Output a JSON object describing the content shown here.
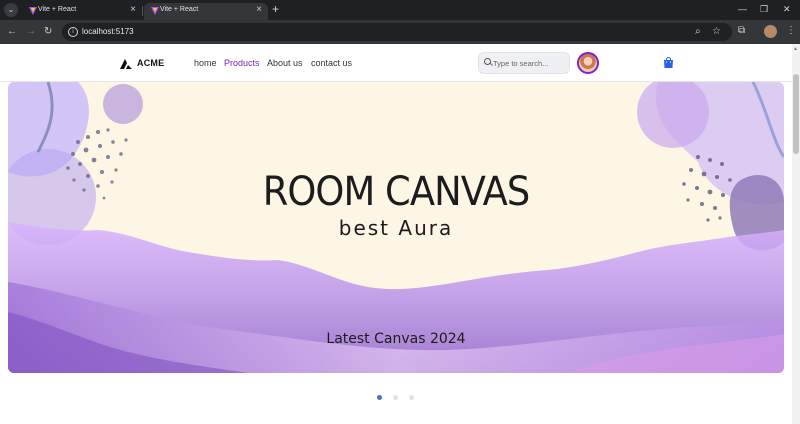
{
  "browser": {
    "tabs": [
      {
        "title": "Vite + React",
        "active": false
      },
      {
        "title": "Vite + React",
        "active": true
      }
    ],
    "url": "localhost:5173",
    "new_tab_label": "+",
    "window_controls": {
      "minimize": "—",
      "restore": "❐",
      "close": "✕"
    }
  },
  "site": {
    "brand": "ACME",
    "nav": [
      "home",
      "Products",
      "About us",
      "contact us"
    ],
    "active_nav": "Products",
    "search_placeholder": "Type to search..."
  },
  "hero": {
    "title": "ROOM CANVAS",
    "subtitle": "best Aura",
    "caption": "Latest Canvas 2024",
    "slides": 3,
    "active_slide": 1
  },
  "colors": {
    "accent": "#7e22ce",
    "hero_bg": "#fdf6e4",
    "dot_active": "#4a72c4",
    "cart": "#2563eb"
  }
}
